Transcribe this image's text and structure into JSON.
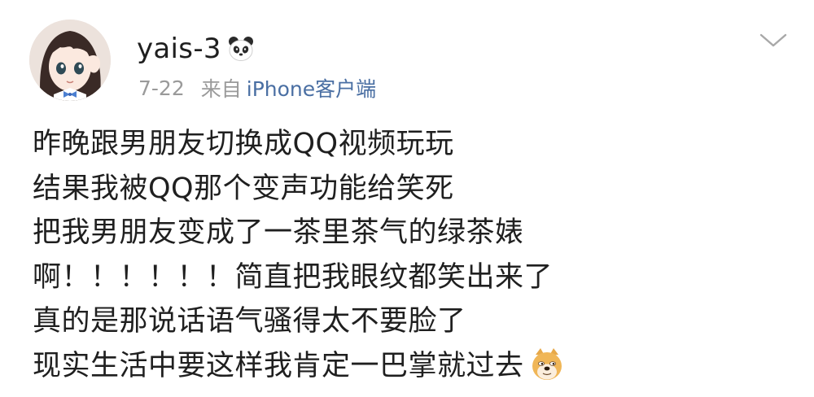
{
  "post": {
    "user": {
      "name": "yais-3",
      "badge_icon": "panda-emoji-icon",
      "avatar_icon": "anime-girl-avatar"
    },
    "meta": {
      "date": "7-22",
      "from_label": "来自",
      "source": "iPhone客户端"
    },
    "menu_icon": "chevron-down-icon",
    "lines": [
      "昨晚跟男朋友切换成QQ视频玩玩",
      "结果我被QQ那个变声功能给笑死",
      "把我男朋友变成了一茶里茶气的绿茶婊",
      "啊！！！！！！简直把我眼纹都笑出来了",
      "真的是那说话语气骚得太不要脸了",
      "现实生活中要这样我肯定一巴掌就过去"
    ],
    "end_emoji": "doge-emoji-icon",
    "colors": {
      "text": "#1f1f1f",
      "meta": "#9a9a9a",
      "source_link": "#4a6fa3"
    }
  }
}
